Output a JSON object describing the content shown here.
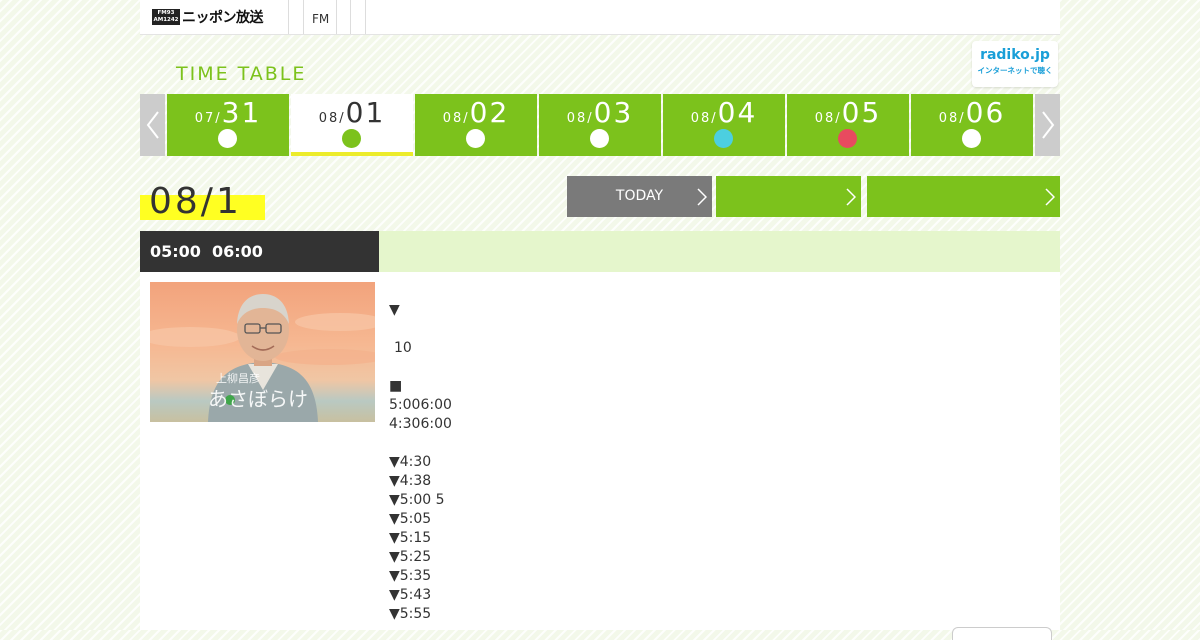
{
  "header": {
    "logo_badge_top": "FM93",
    "logo_badge_bottom": "AM1242",
    "logo_text": "ニッポン放送",
    "nav_fm": "FM"
  },
  "timetable_title": "TIME TABLE",
  "radiko": {
    "logo": "radiko.jp",
    "sub": "インターネットで聴く"
  },
  "date_nav": {
    "prev_icon": "chevron-left-icon",
    "next_icon": "chevron-right-icon",
    "tabs": [
      {
        "month": "07/",
        "day": "31",
        "dot_color": "#ffffff",
        "active": false
      },
      {
        "month": "08/",
        "day": "01",
        "dot_color": "#7cc21c",
        "active": true
      },
      {
        "month": "08/",
        "day": "02",
        "dot_color": "#ffffff",
        "active": false
      },
      {
        "month": "08/",
        "day": "03",
        "dot_color": "#ffffff",
        "active": false
      },
      {
        "month": "08/",
        "day": "04",
        "dot_color": "#4ccfe0",
        "active": false
      },
      {
        "month": "08/",
        "day": "05",
        "dot_color": "#e84a5f",
        "active": false
      },
      {
        "month": "08/",
        "day": "06",
        "dot_color": "#ffffff",
        "active": false
      }
    ]
  },
  "selected_date": "08/1",
  "buttons": {
    "today": "TODAY",
    "middle": "",
    "right": ""
  },
  "program": {
    "start": "05:00",
    "end": "06:00",
    "title": "",
    "image_caption_name": "上柳昌彦",
    "image_caption_title": "あさぼらけ",
    "lines": [
      "▼",
      "10",
      "■",
      "5:006:00",
      "4:306:00",
      "▼4:30",
      "▼4:38",
      "▼5:00 5",
      "▼5:05",
      "▼5:15",
      "▼5:25",
      "▼5:35",
      "▼5:43",
      "▼5:55"
    ]
  },
  "colors": {
    "green": "#7cc21c",
    "highlight": "#ffff22",
    "dark": "#333333",
    "light_green": "#e5f6cc",
    "gray_button": "#7a7a7a"
  }
}
